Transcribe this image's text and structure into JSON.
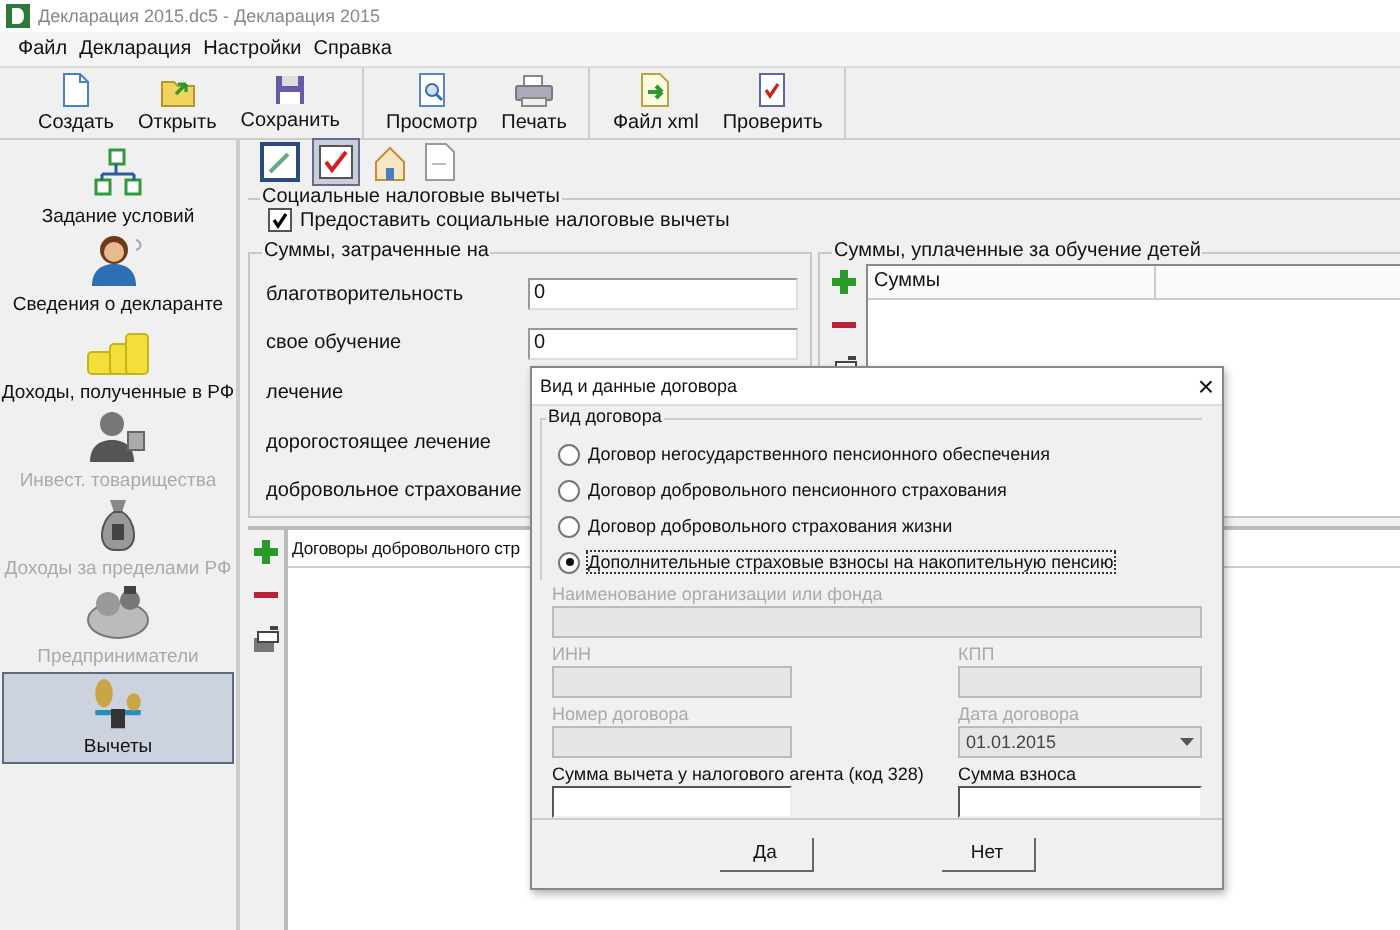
{
  "window": {
    "title": "Декларация 2015.dc5 - Декларация 2015"
  },
  "menu": [
    "Файл",
    "Декларация",
    "Настройки",
    "Справка"
  ],
  "toolbar": [
    {
      "buttons": [
        {
          "label": "Создать",
          "kind": "new"
        },
        {
          "label": "Открыть",
          "kind": "open"
        },
        {
          "label": "Сохранить",
          "kind": "save"
        }
      ]
    },
    {
      "buttons": [
        {
          "label": "Просмотр",
          "kind": "preview"
        },
        {
          "label": "Печать",
          "kind": "print"
        }
      ]
    },
    {
      "buttons": [
        {
          "label": "Файл xml",
          "kind": "xml"
        },
        {
          "label": "Проверить",
          "kind": "check"
        }
      ]
    }
  ],
  "sidebar": {
    "items": [
      {
        "label": "Задание условий",
        "kind": "conditions",
        "disabled": false,
        "selected": false
      },
      {
        "label": "Сведения о декларанте",
        "kind": "declarant",
        "disabled": false,
        "selected": false
      },
      {
        "label": "Доходы, полученные в РФ",
        "kind": "income",
        "disabled": false,
        "selected": false
      },
      {
        "label": "Инвест. товарищества",
        "kind": "invest",
        "disabled": true,
        "selected": false
      },
      {
        "label": "Доходы за пределами РФ",
        "kind": "abroad",
        "disabled": true,
        "selected": false
      },
      {
        "label": "Предприниматели",
        "kind": "business",
        "disabled": true,
        "selected": false
      },
      {
        "label": "Вычеты",
        "kind": "deductions",
        "disabled": false,
        "selected": true
      }
    ]
  },
  "section_tabs": [
    {
      "kind": "edit",
      "selected": false
    },
    {
      "kind": "check",
      "selected": true
    },
    {
      "kind": "house",
      "selected": false
    },
    {
      "kind": "page",
      "selected": false
    }
  ],
  "social": {
    "title": "Социальные налоговые вычеты",
    "checkbox": {
      "label": "Предоставить социальные налоговые вычеты",
      "checked": true
    }
  },
  "expenses": {
    "title": "Суммы, затраченные на",
    "rows": [
      {
        "label": "благотворительность",
        "value": "0"
      },
      {
        "label": "свое обучение",
        "value": "0"
      },
      {
        "label": "лечение"
      },
      {
        "label": "дорогостоящее лечение"
      },
      {
        "label": "добровольное страхование"
      }
    ]
  },
  "children_education": {
    "title": "Суммы, уплаченные за обучение детей",
    "columns": [
      "Суммы"
    ]
  },
  "contracts": {
    "columns": [
      "Договоры добровольного стр"
    ]
  },
  "dialog": {
    "title": "Вид и данные договора",
    "close": "×",
    "group_title": "Вид договора",
    "options": [
      {
        "label": "Договор негосударственного пенсионного обеспечения",
        "selected": false
      },
      {
        "label": "Договор добровольного пенсионного страхования",
        "selected": false
      },
      {
        "label": "Договор добровольного страхования жизни",
        "selected": false
      },
      {
        "label": "Дополнительные страховые взносы на накопительную пенсию",
        "selected": true
      }
    ],
    "fields": [
      {
        "label": "Наименование организации или фонда",
        "kind": "wide",
        "disabled": true
      },
      {
        "label": "ИНН",
        "kind": "left",
        "disabled": true
      },
      {
        "label": "КПП",
        "kind": "right",
        "disabled": true
      },
      {
        "label": "Номер договора",
        "kind": "left",
        "disabled": true
      },
      {
        "label": "Дата договора",
        "kind": "date",
        "disabled": true,
        "value": "01.01.2015"
      },
      {
        "label": "Сумма вычета у налогового агента (код 328)",
        "kind": "left",
        "disabled": false
      },
      {
        "label": "Сумма взноса",
        "kind": "right",
        "disabled": false
      }
    ],
    "buttons": [
      "Да",
      "Нет"
    ]
  }
}
